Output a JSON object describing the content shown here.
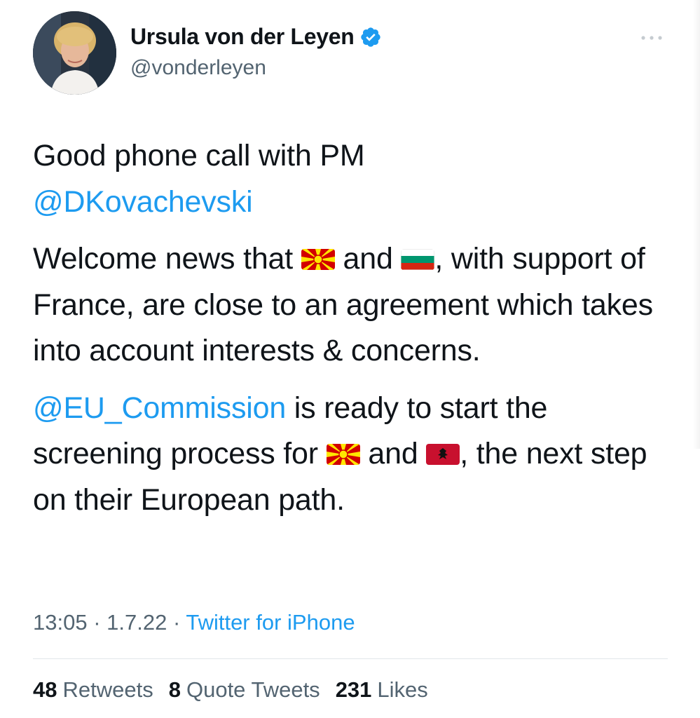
{
  "author": {
    "display_name": "Ursula von der Leyen",
    "handle": "@vonderleyen",
    "verified": true
  },
  "menu": {
    "icon": "more-horizontal-icon"
  },
  "tweet": {
    "line1": "Good phone call with PM",
    "mention1": "@DKovachevski",
    "p2": {
      "t1": "Welcome news that ",
      "t2": " and ",
      "t3": ", with support of France, are close to an agreement which takes into account interests & concerns."
    },
    "p3": {
      "mention": "@EU_Commission",
      "t1": " is ready to start the screening process for ",
      "t2": " and ",
      "t3": ", the next step on their European path."
    },
    "flags": [
      "north-macedonia-flag-icon",
      "bulgaria-flag-icon",
      "north-macedonia-flag-icon",
      "albania-flag-icon"
    ]
  },
  "meta": {
    "time": "13:05",
    "sep1": " · ",
    "date": "1.7.22",
    "sep2": " · ",
    "source": "Twitter for iPhone"
  },
  "stats": {
    "retweets_count": "48",
    "retweets_label": "Retweets",
    "quotes_count": "8",
    "quotes_label": "Quote Tweets",
    "likes_count": "231",
    "likes_label": "Likes"
  },
  "colors": {
    "link": "#1d9bf0",
    "text": "#0f1419",
    "muted": "#536471",
    "divider": "#e1e6ea"
  }
}
